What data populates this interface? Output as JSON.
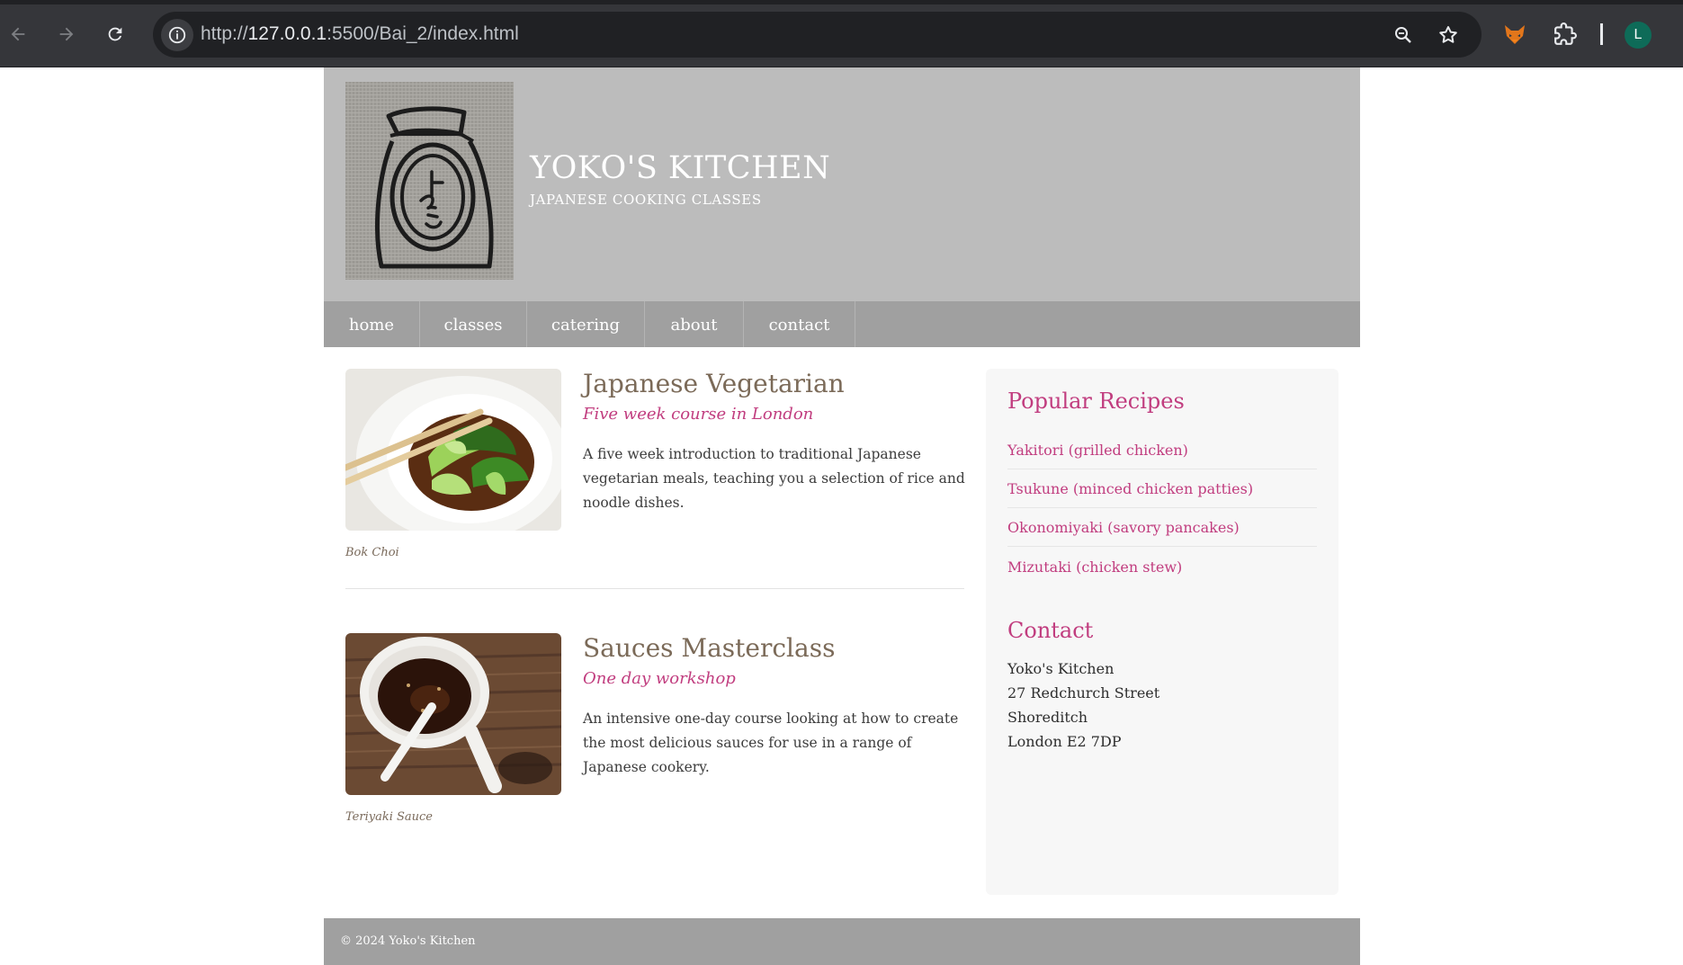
{
  "browser": {
    "url_scheme": "http://",
    "url_host": "127.0.0.1",
    "url_rest": ":5500/Bai_2/index.html",
    "avatar_letter": "L",
    "icons": [
      "back-icon",
      "forward-icon",
      "reload-icon",
      "site-info-icon",
      "zoom-icon",
      "bookmark-star-icon",
      "fox-extension-icon",
      "extensions-puzzle-icon"
    ]
  },
  "header": {
    "title": "YOKO'S KITCHEN",
    "subtitle": "JAPANESE COOKING CLASSES"
  },
  "nav": {
    "items": [
      "home",
      "classes",
      "catering",
      "about",
      "contact"
    ]
  },
  "articles": [
    {
      "title": "Japanese Vegetarian",
      "subtitle": "Five week course in London",
      "description": "A five week introduction to traditional Japanese vegetarian meals, teaching you a selection of rice and noodle dishes.",
      "caption": "Bok Choi"
    },
    {
      "title": "Sauces Masterclass",
      "subtitle": "One day workshop",
      "description": "An intensive one-day course looking at how to create the most delicious sauces for use in a range of Japanese cookery.",
      "caption": "Teriyaki Sauce"
    }
  ],
  "sidebar": {
    "recipes_heading": "Popular Recipes",
    "recipes": [
      "Yakitori (grilled chicken)",
      "Tsukune (minced chicken patties)",
      "Okonomiyaki (savory pancakes)",
      "Mizutaki (chicken stew)"
    ],
    "contact_heading": "Contact",
    "address": [
      "Yoko's Kitchen",
      "27 Redchurch Street",
      "Shoreditch",
      "London E2 7DP"
    ]
  },
  "footer": {
    "copyright": "© 2024 Yoko's Kitchen"
  },
  "colors": {
    "accent_pink": "#c13d7f",
    "heading_brown": "#7b6a58",
    "masthead_gray": "#bcbcbc",
    "nav_gray": "#a0a0a0"
  }
}
